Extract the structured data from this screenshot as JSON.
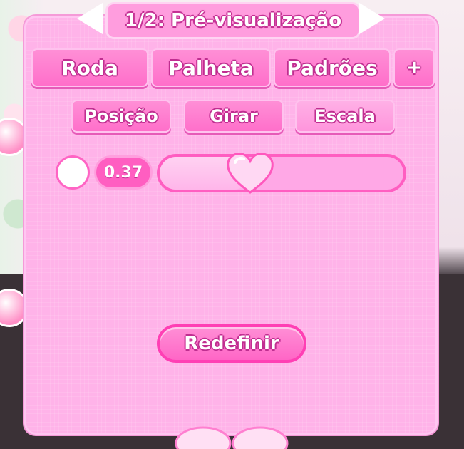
{
  "window": {
    "title": "1/2: Pré-visualização"
  },
  "tabs": [
    {
      "label": "Roda"
    },
    {
      "label": "Palheta"
    },
    {
      "label": "Padrões"
    },
    {
      "label": "+"
    }
  ],
  "transform_tabs": [
    {
      "label": "Posição"
    },
    {
      "label": "Girar"
    },
    {
      "label": "Escala",
      "active": true
    }
  ],
  "scale": {
    "value_text": "0.37",
    "level": 0.37
  },
  "reset": {
    "label": "Redefinir"
  },
  "colors": {
    "panel": "#ffb3e9",
    "accent": "#ff5ec1",
    "button": "#ff7fd0"
  },
  "icons": {
    "prev": "arrow-left-icon",
    "next": "arrow-right-icon",
    "knob": "heart-icon",
    "swatch": "color-swatch-icon"
  }
}
